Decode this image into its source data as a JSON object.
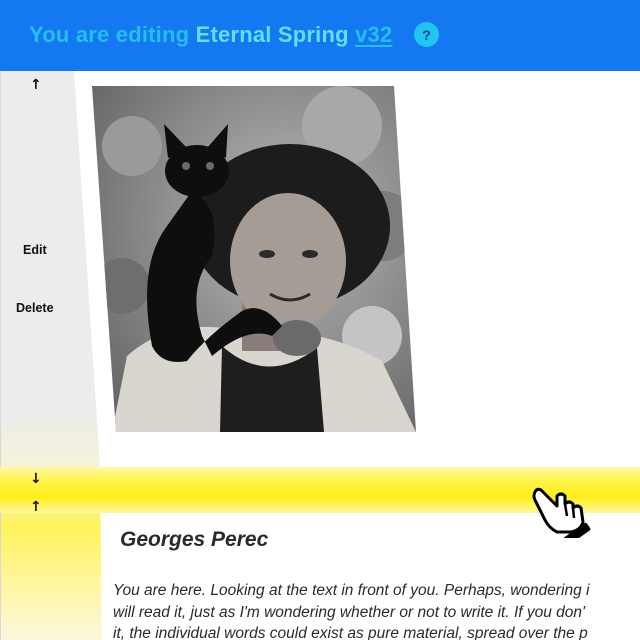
{
  "header": {
    "prefix": "You are editing",
    "doc_name": "Eternal Spring",
    "version": "v32",
    "help_label": "?"
  },
  "sidebar": {
    "move_up_top": "↑",
    "edit_label": "Edit",
    "delete_label": "Delete",
    "move_down": "↓",
    "move_up_bottom": "↑"
  },
  "photo": {
    "subject": "black-and-white portrait of a curly-haired man with a black cat on his shoulder"
  },
  "article": {
    "title": "Georges Perec",
    "lines": [
      "You are here. Looking at the text in front of you. Perhaps, wondering i",
      "will read it, just as I'm wondering whether or not to write it. If you don'",
      "it, the individual words could exist as pure material, spread over the p"
    ]
  },
  "colors": {
    "topbar": "#1478f0",
    "title_text": "#25bdf2",
    "highlight": "#fff34a",
    "sidebar": "#ececec"
  },
  "cursor": {
    "icon": "hand-pointer-icon"
  }
}
